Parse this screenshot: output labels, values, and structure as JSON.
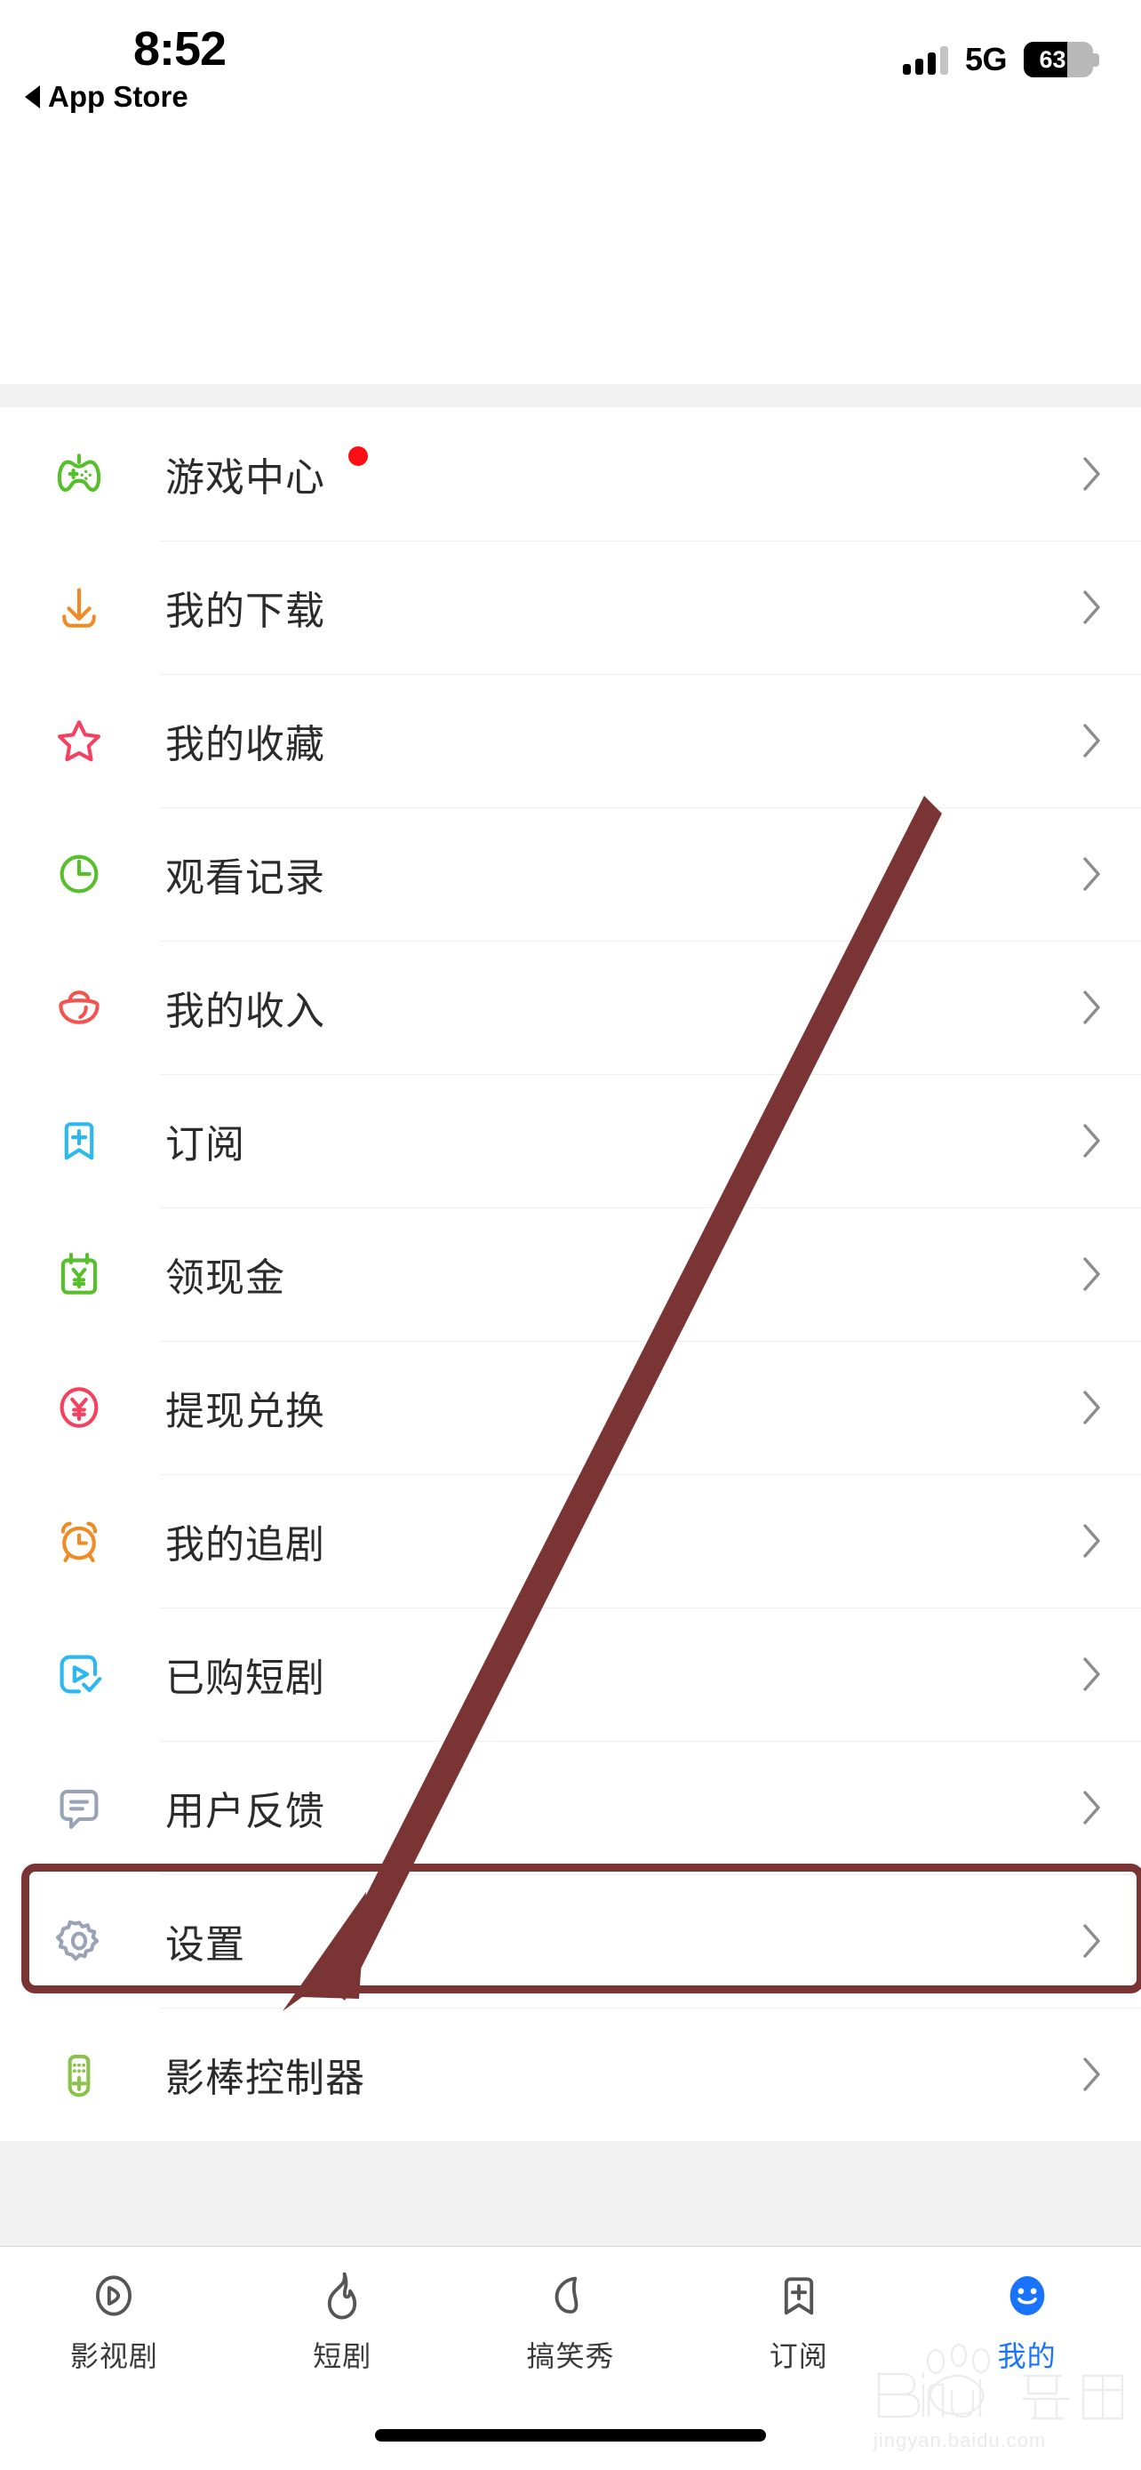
{
  "status_bar": {
    "time": "8:52",
    "back_label": "App Store",
    "network": "5G",
    "battery_percent": "63",
    "battery_level": 63,
    "signal_icon": "signal-bars-icon",
    "battery_icon": "battery-icon"
  },
  "menu": {
    "items": [
      {
        "label": "游戏中心",
        "icon": "gamepad-icon",
        "color": "#56c02b",
        "badge": true
      },
      {
        "label": "我的下载",
        "icon": "download-icon",
        "color": "#f08a24",
        "badge": false
      },
      {
        "label": "我的收藏",
        "icon": "star-icon",
        "color": "#f6405f",
        "badge": false
      },
      {
        "label": "观看记录",
        "icon": "clock-icon",
        "color": "#56c02b",
        "badge": false
      },
      {
        "label": "我的收入",
        "icon": "ingot-icon",
        "color": "#f4544f",
        "badge": false
      },
      {
        "label": "订阅",
        "icon": "bookmark-plus-icon",
        "color": "#2bb8f0",
        "badge": false
      },
      {
        "label": "领现金",
        "icon": "cash-calendar-icon",
        "color": "#56c02b",
        "badge": false
      },
      {
        "label": "提现兑换",
        "icon": "yuan-circle-icon",
        "color": "#f6405f",
        "badge": false
      },
      {
        "label": "我的追剧",
        "icon": "alarm-clock-icon",
        "color": "#f08a24",
        "badge": false
      },
      {
        "label": "已购短剧",
        "icon": "play-check-icon",
        "color": "#2bb8f0",
        "badge": false
      },
      {
        "label": "用户反馈",
        "icon": "speech-bubble-icon",
        "color": "#9aa3b5",
        "badge": false
      },
      {
        "label": "设置",
        "icon": "gear-icon",
        "color": "#9aa3b5",
        "badge": false,
        "highlighted": true
      },
      {
        "label": "影棒控制器",
        "icon": "remote-control-icon",
        "color": "#8bc34a",
        "badge": false
      }
    ],
    "chevron_icon": "chevron-right-icon"
  },
  "annotation": {
    "type": "arrow",
    "color": "#7a3434",
    "highlight_color": "#7a3434",
    "points_to": "设置"
  },
  "tabbar": {
    "tabs": [
      {
        "label": "影视剧",
        "icon": "play-circle-icon",
        "active": false
      },
      {
        "label": "短剧",
        "icon": "flame-icon",
        "active": false
      },
      {
        "label": "搞笑秀",
        "icon": "droplet-icon",
        "active": false
      },
      {
        "label": "订阅",
        "icon": "bookmark-plus-icon",
        "active": false
      },
      {
        "label": "我的",
        "icon": "smiley-face-icon",
        "active": true
      }
    ],
    "active_color": "#1a73ff"
  },
  "watermark": {
    "brand": "Baidu",
    "suffix": "经验",
    "url": "jingyan.baidu.com"
  }
}
